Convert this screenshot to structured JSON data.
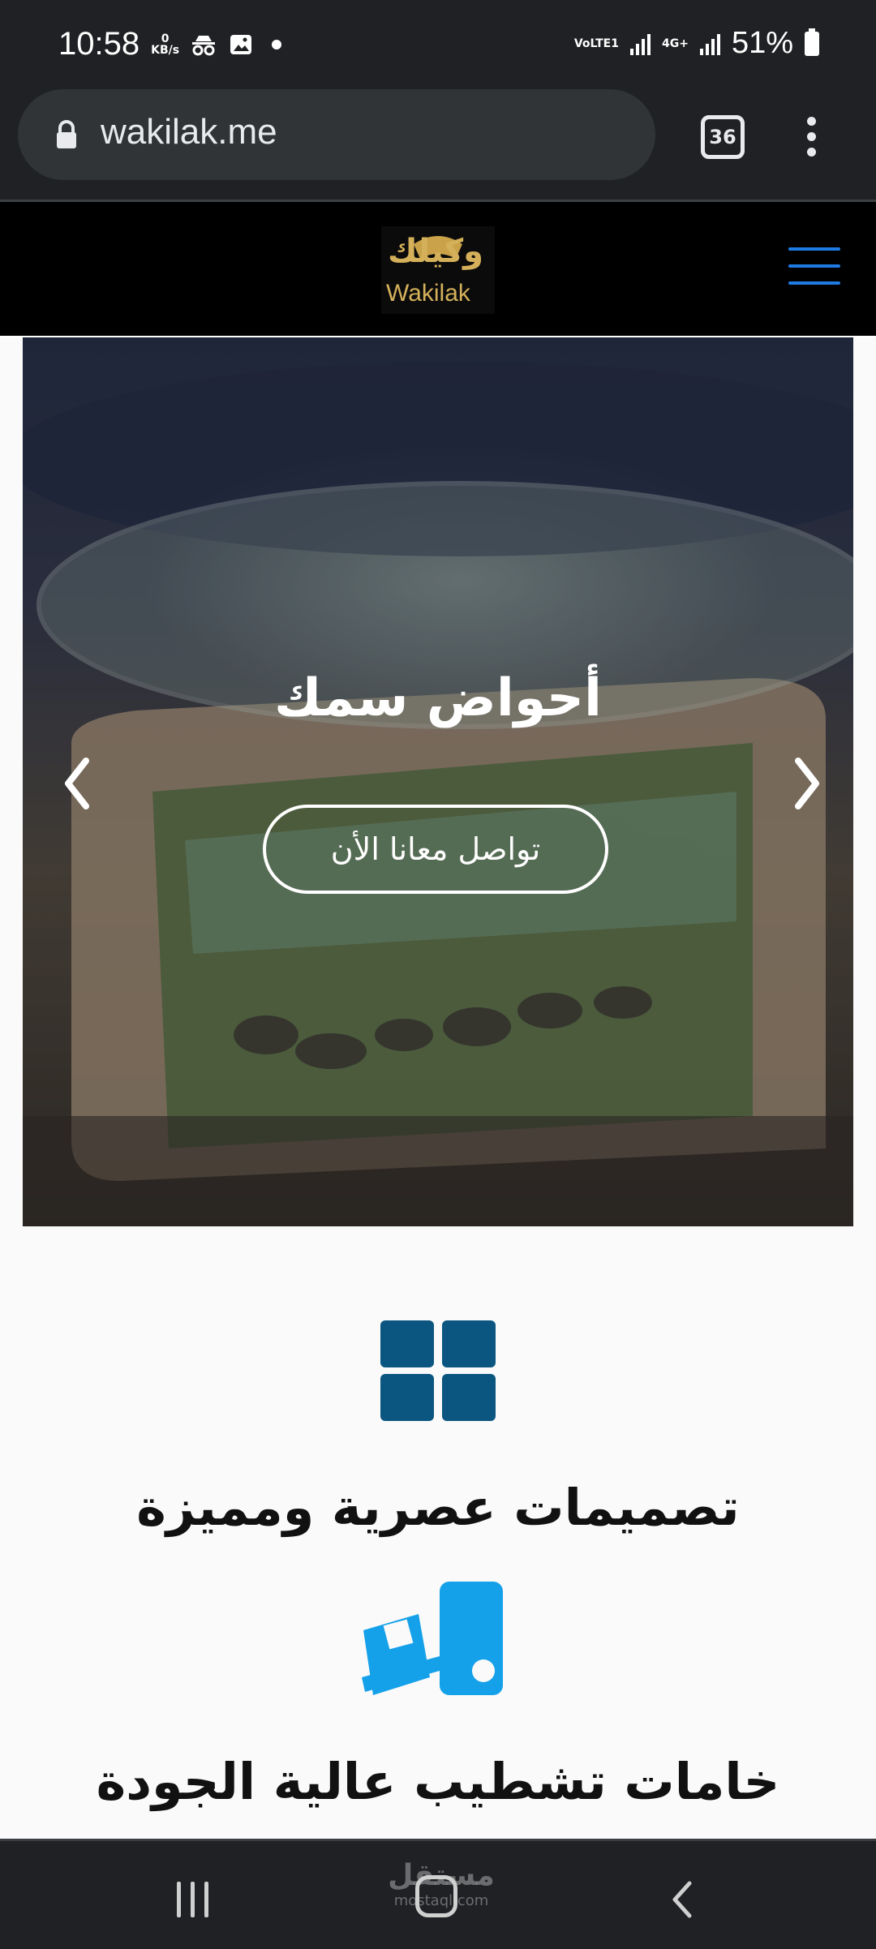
{
  "status_bar": {
    "time": "10:58",
    "net_speed_value": "0",
    "net_speed_unit": "KB/s",
    "lte_label": "VoLTE1",
    "net_type": "4G+",
    "battery_percent": "51%",
    "icons": [
      "incognito-icon",
      "image-icon",
      "notification-dot",
      "signal-icon",
      "battery-icon"
    ]
  },
  "browser": {
    "url": "wakilak.me",
    "tab_count": "36",
    "icons": [
      "lock-icon",
      "tabs-icon",
      "more-vert-icon"
    ]
  },
  "site_header": {
    "logo_arabic": "وكيلك",
    "logo_english": "Wakilak",
    "menu_color": "#1f7be4"
  },
  "hero": {
    "title": "أحواض سمك",
    "cta_label": "تواصل معانا الأن"
  },
  "features": [
    {
      "title": "تصميمات عصرية ومميزة",
      "icon": "grid-icon",
      "color": "#0b5680"
    },
    {
      "title": "خامات تشطيب عالية الجودة",
      "icon": "truck-icon",
      "color": "#15a1ea"
    }
  ],
  "watermark": {
    "arabic": "مستقل",
    "english": "mostaql.com"
  }
}
